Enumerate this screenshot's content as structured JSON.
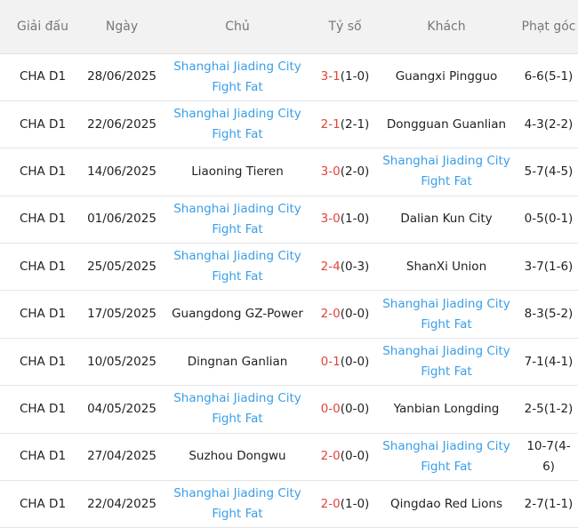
{
  "highlight_color": "#3a9ee8",
  "score_color": "#e0453a",
  "headers": [
    "Giải đấu",
    "Ngày",
    "Chủ",
    "Tỷ số",
    "Khách",
    "Phạt góc"
  ],
  "rows": [
    {
      "league": "CHA D1",
      "date": "28/06/2025",
      "home": "Shanghai Jiading City Fight Fat",
      "home_hl": true,
      "score": "3-1",
      "half": "(1-0)",
      "away": "Guangxi Pingguo",
      "away_hl": false,
      "corners": "6-6(5-1)"
    },
    {
      "league": "CHA D1",
      "date": "22/06/2025",
      "home": "Shanghai Jiading City Fight Fat",
      "home_hl": true,
      "score": "2-1",
      "half": "(2-1)",
      "away": "Dongguan Guanlian",
      "away_hl": false,
      "corners": "4-3(2-2)"
    },
    {
      "league": "CHA D1",
      "date": "14/06/2025",
      "home": "Liaoning Tieren",
      "home_hl": false,
      "score": "3-0",
      "half": "(2-0)",
      "away": "Shanghai Jiading City Fight Fat",
      "away_hl": true,
      "corners": "5-7(4-5)"
    },
    {
      "league": "CHA D1",
      "date": "01/06/2025",
      "home": "Shanghai Jiading City Fight Fat",
      "home_hl": true,
      "score": "3-0",
      "half": "(1-0)",
      "away": "Dalian Kun City",
      "away_hl": false,
      "corners": "0-5(0-1)"
    },
    {
      "league": "CHA D1",
      "date": "25/05/2025",
      "home": "Shanghai Jiading City Fight Fat",
      "home_hl": true,
      "score": "2-4",
      "half": "(0-3)",
      "away": "ShanXi Union",
      "away_hl": false,
      "corners": "3-7(1-6)"
    },
    {
      "league": "CHA D1",
      "date": "17/05/2025",
      "home": "Guangdong GZ-Power",
      "home_hl": false,
      "score": "2-0",
      "half": "(0-0)",
      "away": "Shanghai Jiading City Fight Fat",
      "away_hl": true,
      "corners": "8-3(5-2)"
    },
    {
      "league": "CHA D1",
      "date": "10/05/2025",
      "home": "Dingnan Ganlian",
      "home_hl": false,
      "score": "0-1",
      "half": "(0-0)",
      "away": "Shanghai Jiading City Fight Fat",
      "away_hl": true,
      "corners": "7-1(4-1)"
    },
    {
      "league": "CHA D1",
      "date": "04/05/2025",
      "home": "Shanghai Jiading City Fight Fat",
      "home_hl": true,
      "score": "0-0",
      "half": "(0-0)",
      "away": "Yanbian Longding",
      "away_hl": false,
      "corners": "2-5(1-2)"
    },
    {
      "league": "CHA D1",
      "date": "27/04/2025",
      "home": "Suzhou Dongwu",
      "home_hl": false,
      "score": "2-0",
      "half": "(0-0)",
      "away": "Shanghai Jiading City Fight Fat",
      "away_hl": true,
      "corners": "10-7(4-6)"
    },
    {
      "league": "CHA D1",
      "date": "22/04/2025",
      "home": "Shanghai Jiading City Fight Fat",
      "home_hl": true,
      "score": "2-0",
      "half": "(1-0)",
      "away": "Qingdao Red Lions",
      "away_hl": false,
      "corners": "2-7(1-1)"
    }
  ]
}
